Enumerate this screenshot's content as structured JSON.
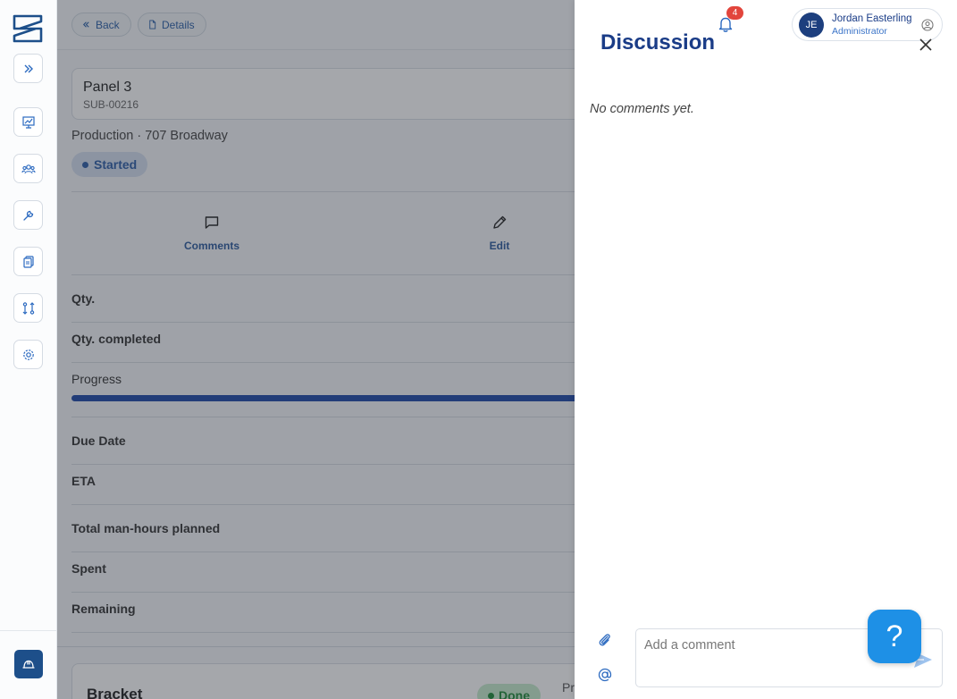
{
  "topbar": {
    "back_label": "Back",
    "details_label": "Details"
  },
  "item": {
    "name": "Panel 3",
    "code": "SUB-00216",
    "meta": "Production · 707 Broadway",
    "status": "Started"
  },
  "actions": {
    "comments_label": "Comments",
    "edit_label": "Edit"
  },
  "fields": {
    "qty": "Qty.",
    "qty_completed": "Qty. completed",
    "progress": "Progress",
    "progress_value": 1.0,
    "due_date": "Due Date",
    "eta": "ETA",
    "total_hours": "Total man-hours planned",
    "spent": "Spent",
    "remaining": "Remaining"
  },
  "next_item": {
    "name": "Bracket",
    "status": "Done",
    "meta_partial": "Pr"
  },
  "discussion": {
    "title": "Discussion",
    "empty_text": "No comments yet.",
    "comment_placeholder": "Add a comment"
  },
  "notifications": {
    "count": "4"
  },
  "user": {
    "initials": "JE",
    "name": "Jordan Easterling",
    "role": "Administrator"
  },
  "help": {
    "label": "?"
  },
  "colors": {
    "brand": "#1a3c87",
    "accent": "#2c5a9d",
    "help": "#1e90e6",
    "badge": "#e2453c"
  }
}
